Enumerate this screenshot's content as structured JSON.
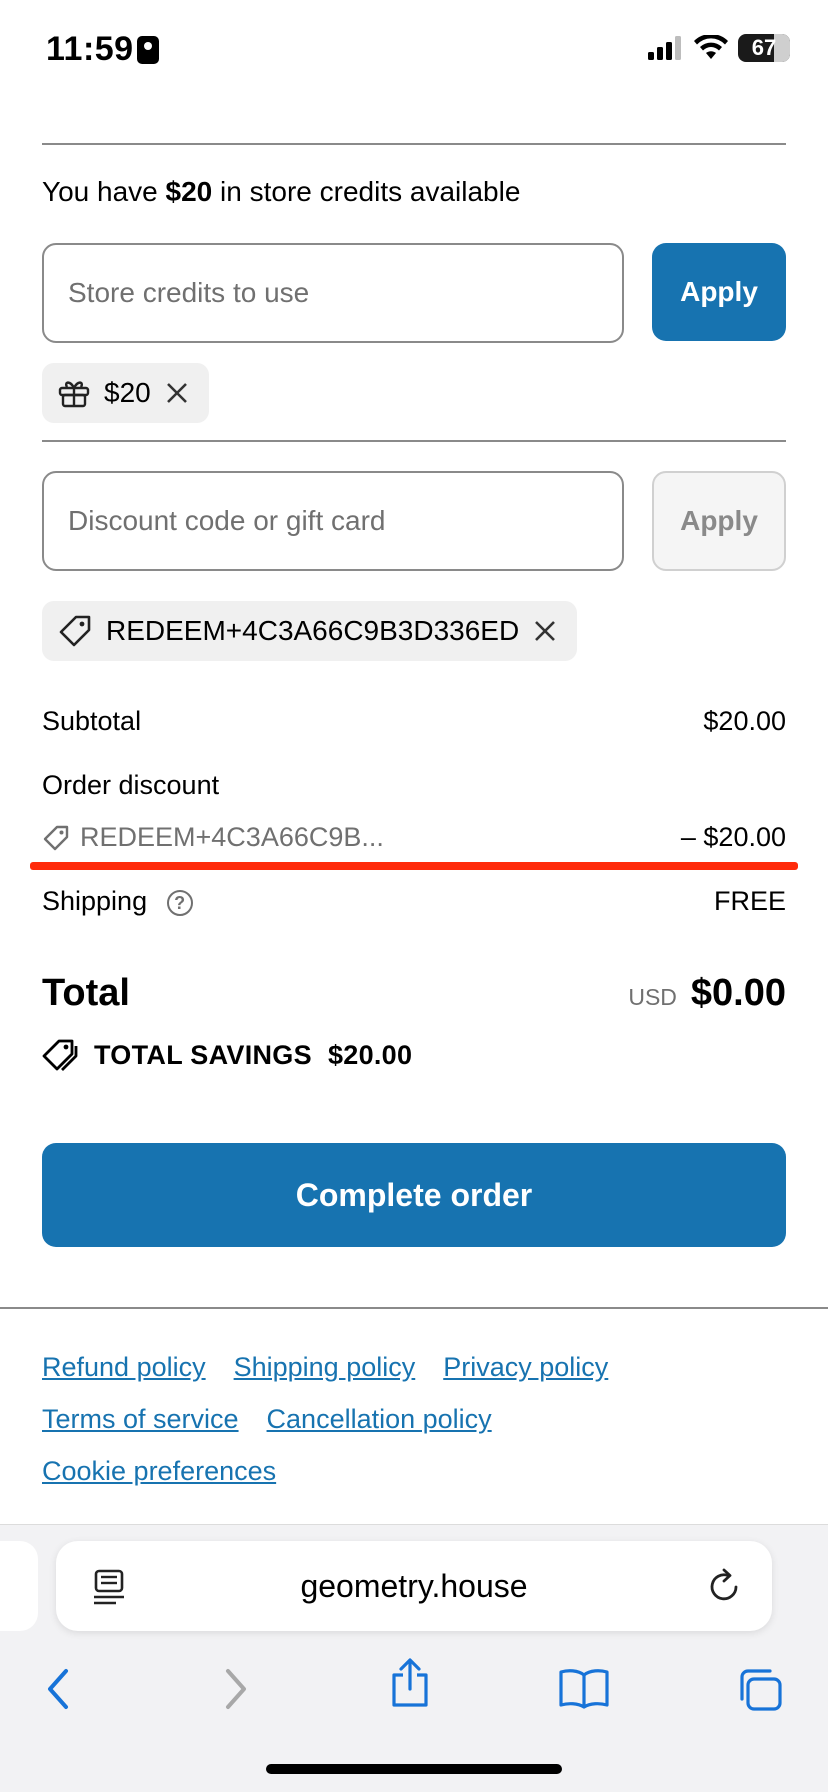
{
  "status_bar": {
    "time": "11:59",
    "battery": "67"
  },
  "store_credits": {
    "text_prefix": "You have",
    "amount": "$20",
    "text_suffix": "in store credits available",
    "input_placeholder": "Store credits to use",
    "apply_label": "Apply",
    "applied_chip": "$20"
  },
  "discount": {
    "input_placeholder": "Discount code or gift card",
    "apply_label": "Apply",
    "applied_code": "REDEEM+4C3A66C9B3D336ED"
  },
  "summary": {
    "subtotal_label": "Subtotal",
    "subtotal_value": "$20.00",
    "order_discount_label": "Order discount",
    "discount_code_truncated": "REDEEM+4C3A66C9B...",
    "discount_value": "– $20.00",
    "shipping_label": "Shipping",
    "shipping_value": "FREE",
    "total_label": "Total",
    "total_currency": "USD",
    "total_value": "$0.00",
    "savings_label": "TOTAL SAVINGS",
    "savings_value": "$20.00"
  },
  "complete_order_label": "Complete order",
  "footer_links": {
    "refund": "Refund policy",
    "shipping": "Shipping policy",
    "privacy": "Privacy policy",
    "terms": "Terms of service",
    "cancellation": "Cancellation policy",
    "cookies": "Cookie preferences"
  },
  "browser": {
    "url": "geometry.house"
  },
  "colors": {
    "primary": "#1773b0",
    "highlight": "#ff2a0a"
  }
}
